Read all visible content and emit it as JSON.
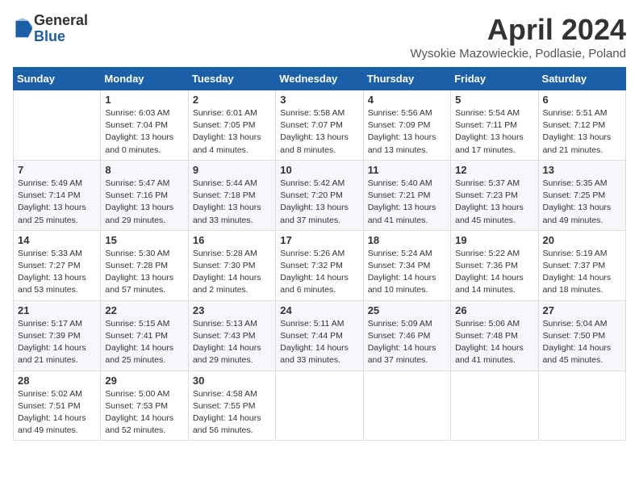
{
  "logo": {
    "general": "General",
    "blue": "Blue"
  },
  "title": {
    "month": "April 2024",
    "location": "Wysokie Mazowieckie, Podlasie, Poland"
  },
  "weekdays": [
    "Sunday",
    "Monday",
    "Tuesday",
    "Wednesday",
    "Thursday",
    "Friday",
    "Saturday"
  ],
  "weeks": [
    [
      {
        "day": "",
        "info": ""
      },
      {
        "day": "1",
        "info": "Sunrise: 6:03 AM\nSunset: 7:04 PM\nDaylight: 13 hours\nand 0 minutes."
      },
      {
        "day": "2",
        "info": "Sunrise: 6:01 AM\nSunset: 7:05 PM\nDaylight: 13 hours\nand 4 minutes."
      },
      {
        "day": "3",
        "info": "Sunrise: 5:58 AM\nSunset: 7:07 PM\nDaylight: 13 hours\nand 8 minutes."
      },
      {
        "day": "4",
        "info": "Sunrise: 5:56 AM\nSunset: 7:09 PM\nDaylight: 13 hours\nand 13 minutes."
      },
      {
        "day": "5",
        "info": "Sunrise: 5:54 AM\nSunset: 7:11 PM\nDaylight: 13 hours\nand 17 minutes."
      },
      {
        "day": "6",
        "info": "Sunrise: 5:51 AM\nSunset: 7:12 PM\nDaylight: 13 hours\nand 21 minutes."
      }
    ],
    [
      {
        "day": "7",
        "info": "Sunrise: 5:49 AM\nSunset: 7:14 PM\nDaylight: 13 hours\nand 25 minutes."
      },
      {
        "day": "8",
        "info": "Sunrise: 5:47 AM\nSunset: 7:16 PM\nDaylight: 13 hours\nand 29 minutes."
      },
      {
        "day": "9",
        "info": "Sunrise: 5:44 AM\nSunset: 7:18 PM\nDaylight: 13 hours\nand 33 minutes."
      },
      {
        "day": "10",
        "info": "Sunrise: 5:42 AM\nSunset: 7:20 PM\nDaylight: 13 hours\nand 37 minutes."
      },
      {
        "day": "11",
        "info": "Sunrise: 5:40 AM\nSunset: 7:21 PM\nDaylight: 13 hours\nand 41 minutes."
      },
      {
        "day": "12",
        "info": "Sunrise: 5:37 AM\nSunset: 7:23 PM\nDaylight: 13 hours\nand 45 minutes."
      },
      {
        "day": "13",
        "info": "Sunrise: 5:35 AM\nSunset: 7:25 PM\nDaylight: 13 hours\nand 49 minutes."
      }
    ],
    [
      {
        "day": "14",
        "info": "Sunrise: 5:33 AM\nSunset: 7:27 PM\nDaylight: 13 hours\nand 53 minutes."
      },
      {
        "day": "15",
        "info": "Sunrise: 5:30 AM\nSunset: 7:28 PM\nDaylight: 13 hours\nand 57 minutes."
      },
      {
        "day": "16",
        "info": "Sunrise: 5:28 AM\nSunset: 7:30 PM\nDaylight: 14 hours\nand 2 minutes."
      },
      {
        "day": "17",
        "info": "Sunrise: 5:26 AM\nSunset: 7:32 PM\nDaylight: 14 hours\nand 6 minutes."
      },
      {
        "day": "18",
        "info": "Sunrise: 5:24 AM\nSunset: 7:34 PM\nDaylight: 14 hours\nand 10 minutes."
      },
      {
        "day": "19",
        "info": "Sunrise: 5:22 AM\nSunset: 7:36 PM\nDaylight: 14 hours\nand 14 minutes."
      },
      {
        "day": "20",
        "info": "Sunrise: 5:19 AM\nSunset: 7:37 PM\nDaylight: 14 hours\nand 18 minutes."
      }
    ],
    [
      {
        "day": "21",
        "info": "Sunrise: 5:17 AM\nSunset: 7:39 PM\nDaylight: 14 hours\nand 21 minutes."
      },
      {
        "day": "22",
        "info": "Sunrise: 5:15 AM\nSunset: 7:41 PM\nDaylight: 14 hours\nand 25 minutes."
      },
      {
        "day": "23",
        "info": "Sunrise: 5:13 AM\nSunset: 7:43 PM\nDaylight: 14 hours\nand 29 minutes."
      },
      {
        "day": "24",
        "info": "Sunrise: 5:11 AM\nSunset: 7:44 PM\nDaylight: 14 hours\nand 33 minutes."
      },
      {
        "day": "25",
        "info": "Sunrise: 5:09 AM\nSunset: 7:46 PM\nDaylight: 14 hours\nand 37 minutes."
      },
      {
        "day": "26",
        "info": "Sunrise: 5:06 AM\nSunset: 7:48 PM\nDaylight: 14 hours\nand 41 minutes."
      },
      {
        "day": "27",
        "info": "Sunrise: 5:04 AM\nSunset: 7:50 PM\nDaylight: 14 hours\nand 45 minutes."
      }
    ],
    [
      {
        "day": "28",
        "info": "Sunrise: 5:02 AM\nSunset: 7:51 PM\nDaylight: 14 hours\nand 49 minutes."
      },
      {
        "day": "29",
        "info": "Sunrise: 5:00 AM\nSunset: 7:53 PM\nDaylight: 14 hours\nand 52 minutes."
      },
      {
        "day": "30",
        "info": "Sunrise: 4:58 AM\nSunset: 7:55 PM\nDaylight: 14 hours\nand 56 minutes."
      },
      {
        "day": "",
        "info": ""
      },
      {
        "day": "",
        "info": ""
      },
      {
        "day": "",
        "info": ""
      },
      {
        "day": "",
        "info": ""
      }
    ]
  ]
}
